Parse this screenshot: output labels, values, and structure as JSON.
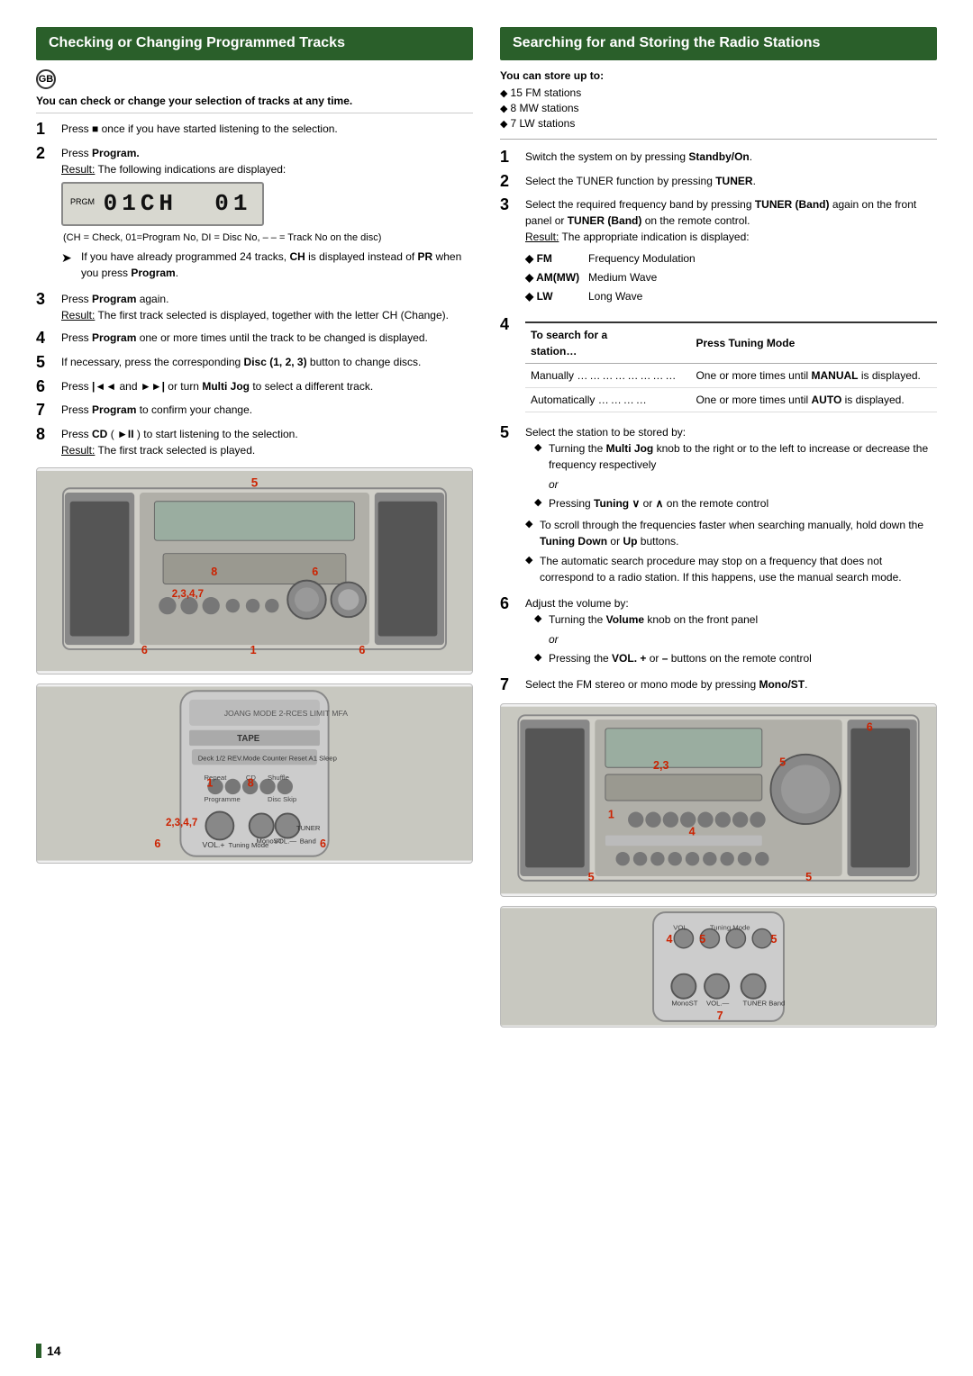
{
  "page": {
    "number": "14",
    "left_section": {
      "title": "Checking or Changing Programmed Tracks",
      "gb_label": "GB",
      "intro": "You can check or change your selection of tracks at any time.",
      "steps": [
        {
          "num": "1",
          "text": "Press ■ once if you have started listening to the selection."
        },
        {
          "num": "2",
          "text": "Press Program.",
          "result": "Result: The following indications are displayed:",
          "display_label": "PRGM",
          "display_text": "01 CH  01",
          "display_note": "(CH = Check, 01=Program No, DI = Disc No, – – = Track No on the disc)",
          "arrow_note": "If you have already programmed 24 tracks, CH is displayed instead of PR when you press Program."
        },
        {
          "num": "3",
          "text": "Press Program again.",
          "result": "Result: The first track selected is displayed, together with the letter CH (Change)."
        },
        {
          "num": "4",
          "text": "Press Program one or more times until the track to be changed is displayed."
        },
        {
          "num": "5",
          "text": "If necessary, press the corresponding Disc (1, 2, 3) button to change discs."
        },
        {
          "num": "6",
          "text": "Press |◄◄ and ►►| or turn Multi Jog to select a different track."
        },
        {
          "num": "7",
          "text": "Press Program to confirm your change."
        },
        {
          "num": "8",
          "text": "Press CD ( ►II ) to start listening to the selection.",
          "result": "Result: The first track selected is played."
        }
      ],
      "image_top_labels": [
        "5",
        "8",
        "6",
        "2,3,4,7",
        "6",
        "1",
        "6"
      ],
      "image_bottom_labels": [
        "1",
        "8",
        "2,3,4,7",
        "6",
        "6"
      ]
    },
    "right_section": {
      "title": "Searching for and Storing the Radio Stations",
      "store_up_label": "You can store up to:",
      "store_bullets": [
        "15 FM stations",
        "8 MW stations",
        "7 LW stations"
      ],
      "steps": [
        {
          "num": "1",
          "text": "Switch the system on by pressing Standby/On."
        },
        {
          "num": "2",
          "text": "Select the TUNER function by pressing TUNER."
        },
        {
          "num": "3",
          "text": "Select the required frequency band by pressing TUNER (Band) again on the front panel or TUNER (Band) on the remote control.",
          "result": "Result: The appropriate indication is displayed:",
          "fm_table": [
            {
              "indicator": "◆ FM",
              "desc": "Frequency Modulation"
            },
            {
              "indicator": "◆ AM(MW)",
              "desc": "Medium Wave"
            },
            {
              "indicator": "◆ LW",
              "desc": "Long Wave"
            }
          ]
        },
        {
          "num": "4",
          "col1_header": "To search for a station…",
          "col2_header": "Press Tuning Mode",
          "rows": [
            {
              "col1": "Manually",
              "col2": "One or more times until MANUAL is displayed."
            },
            {
              "col1": "Automatically",
              "col2": "One or more times until AUTO is displayed."
            }
          ]
        },
        {
          "num": "5",
          "text": "Select the station to be stored by:",
          "bullets": [
            "Turning the Multi Jog knob to the right or to the left to increase or decrease the frequency respectively",
            "or",
            "Pressing Tuning ∨ or ∧ on the remote control"
          ],
          "notes": [
            "To scroll through the frequencies faster when searching manually, hold down the Tuning Down or Up buttons.",
            "The automatic search procedure may stop on a frequency that does not correspond to a radio station. If this happens, use the manual search mode."
          ]
        },
        {
          "num": "6",
          "text": "Adjust the volume by:",
          "bullets": [
            "Turning the Volume knob on the front panel",
            "or",
            "Pressing the VOL. + or – buttons on the remote control"
          ]
        },
        {
          "num": "7",
          "text": "Select the FM stereo or mono mode by pressing Mono/ST."
        }
      ],
      "image_top_labels": [
        "6",
        "2,3",
        "1",
        "5",
        "4",
        "5",
        "5"
      ],
      "image_bottom_labels": [
        "4",
        "5",
        "5",
        "7"
      ]
    }
  }
}
